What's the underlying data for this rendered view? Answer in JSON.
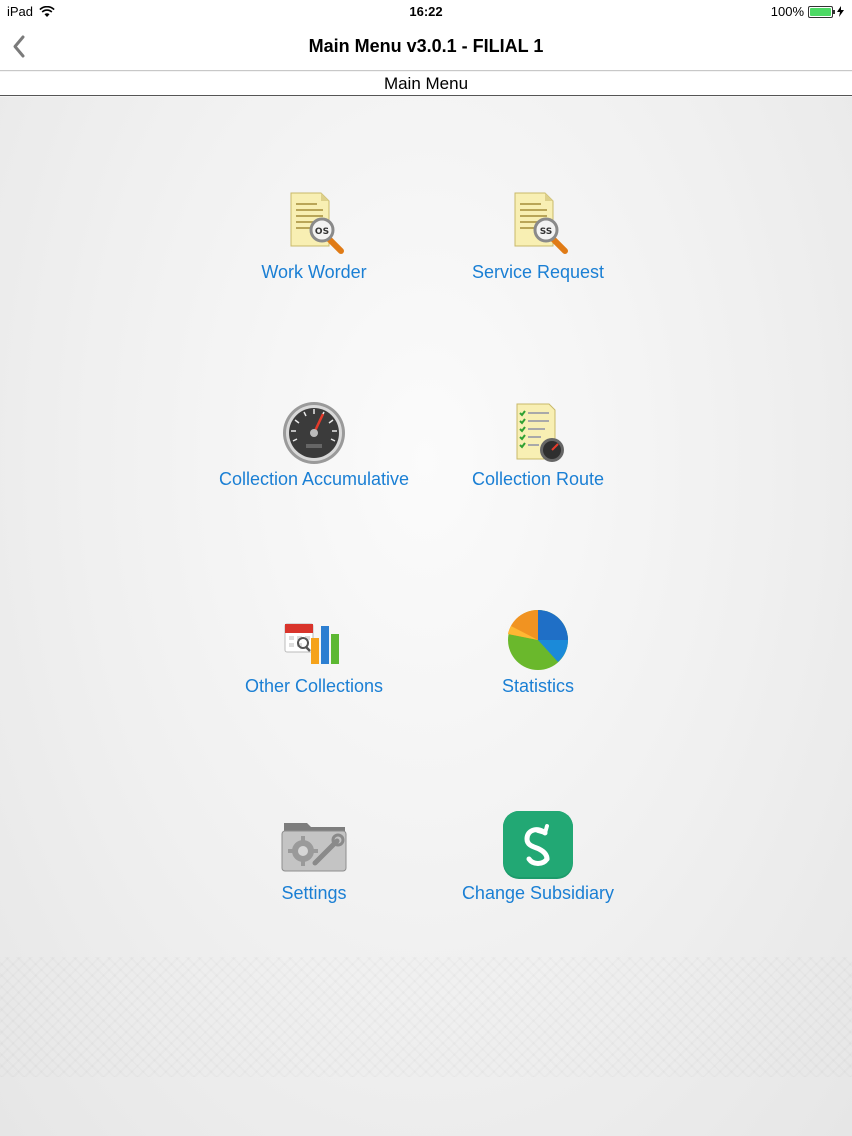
{
  "status": {
    "device": "iPad",
    "time": "16:22",
    "battery": "100%",
    "battery_level": 1.0
  },
  "nav": {
    "title": "Main Menu v3.0.1 - FILIAL 1"
  },
  "sub_header": "Main Menu",
  "menu": [
    {
      "label": "Work Worder",
      "icon": "document-search-icon",
      "badge": "OS"
    },
    {
      "label": "Service Request",
      "icon": "document-search-icon",
      "badge": "SS"
    },
    {
      "label": "Collection Accumulative",
      "icon": "speedometer-icon"
    },
    {
      "label": "Collection Route",
      "icon": "checklist-gauge-icon"
    },
    {
      "label": "Other Collections",
      "icon": "calendar-chart-icon"
    },
    {
      "label": "Statistics",
      "icon": "pie-chart-icon"
    },
    {
      "label": "Settings",
      "icon": "tools-folder-icon"
    },
    {
      "label": "Change Subsidiary",
      "icon": "swap-arrows-icon"
    }
  ],
  "colors": {
    "link": "#1a7fd4",
    "battery": "#4cd964",
    "subsidiary_icon": "#1c9b6b"
  }
}
